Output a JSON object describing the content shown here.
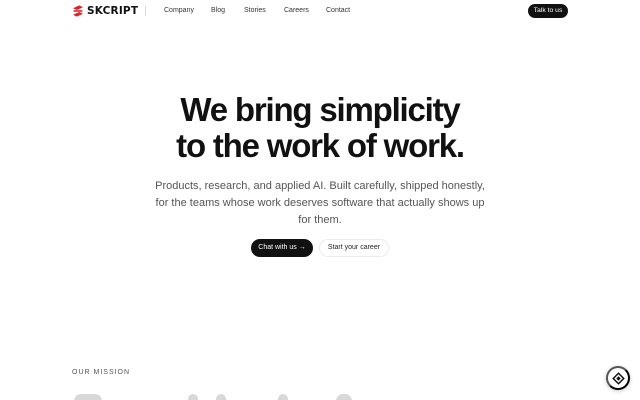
{
  "nav": {
    "brand": "SKCRIPT",
    "links": [
      "Company",
      "Blog",
      "Stories",
      "Careers",
      "Contact"
    ],
    "cta_label": "Talk to us"
  },
  "hero": {
    "title_line1": "We bring simplicity",
    "title_line2": "to the work of work.",
    "subtitle": "Products, research, and applied AI. Built carefully, shipped honestly, for the teams whose work deserves software that actually shows up for them.",
    "primary_label": "Chat with us →",
    "secondary_label": "Start your career"
  },
  "mission": {
    "label": "OUR MISSION"
  },
  "colors": {
    "text": "#111111",
    "muted": "#555555",
    "button_dark": "#111111",
    "brand_red": "#e0202b"
  },
  "icons": {
    "brand": "skcript-logo-icon",
    "floating": "help-widget-icon"
  }
}
